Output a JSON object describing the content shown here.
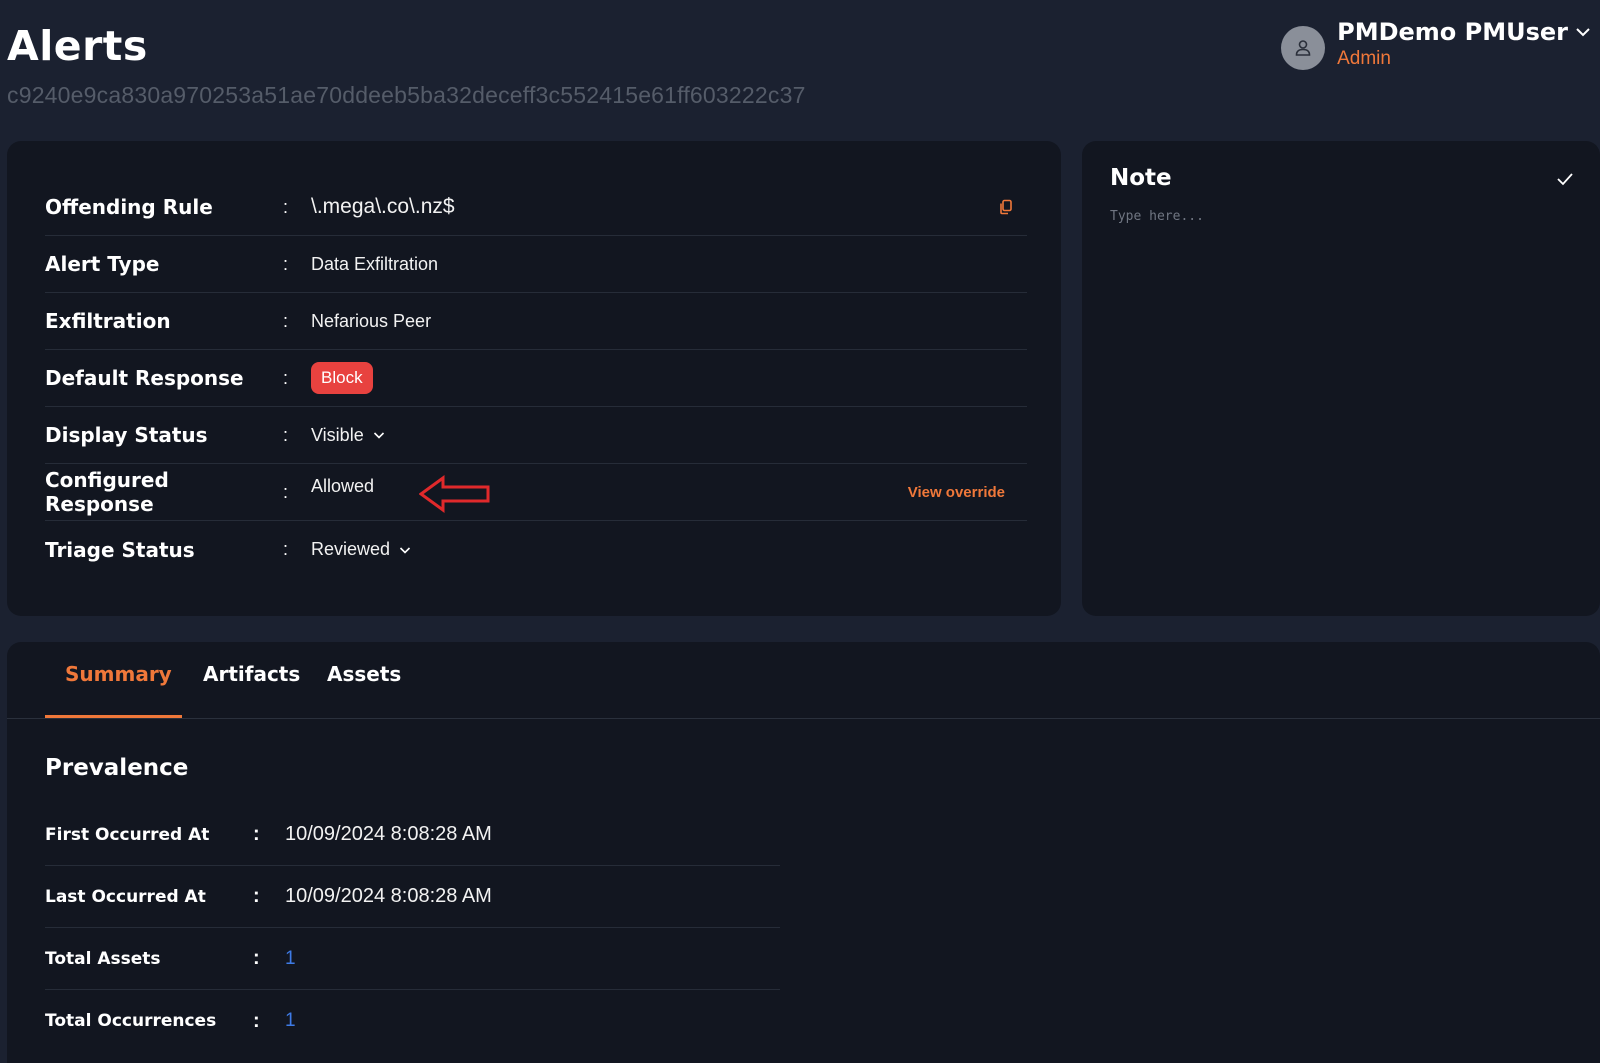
{
  "header": {
    "title": "Alerts",
    "alert_id": "c9240e9ca830a970253a51ae70ddeeb5ba32deceff3c552415e61ff603222c37"
  },
  "user": {
    "name": "PMDemo PMUser",
    "role": "Admin",
    "avatar_icon": "user-icon"
  },
  "details": {
    "offending_rule": {
      "label": "Offending Rule",
      "value": "\\.mega\\.co\\.nz$"
    },
    "alert_type": {
      "label": "Alert Type",
      "value": "Data Exfiltration"
    },
    "exfiltration": {
      "label": "Exfiltration",
      "value": "Nefarious Peer"
    },
    "default_response": {
      "label": "Default Response",
      "value": "Block"
    },
    "display_status": {
      "label": "Display Status",
      "value": "Visible"
    },
    "configured_response": {
      "label": "Configured Response",
      "value": "Allowed",
      "link": "View override"
    },
    "triage_status": {
      "label": "Triage Status",
      "value": "Reviewed"
    },
    "colon": ":"
  },
  "note": {
    "title": "Note",
    "placeholder": "Type here..."
  },
  "tabs": [
    {
      "label": "Summary",
      "active": true
    },
    {
      "label": "Artifacts",
      "active": false
    },
    {
      "label": "Assets",
      "active": false
    }
  ],
  "prevalence": {
    "title": "Prevalence",
    "rows": [
      {
        "label": "First Occurred At",
        "value": "10/09/2024 8:08:28 AM"
      },
      {
        "label": "Last Occurred At",
        "value": "10/09/2024 8:08:28 AM"
      },
      {
        "label": "Total Assets",
        "value": "1"
      },
      {
        "label": "Total Occurrences",
        "value": "1"
      }
    ]
  },
  "colors": {
    "background": "#1b2130",
    "card": "#121620",
    "accent": "#f0783a",
    "danger": "#e8423f",
    "link": "#3e7be6"
  }
}
